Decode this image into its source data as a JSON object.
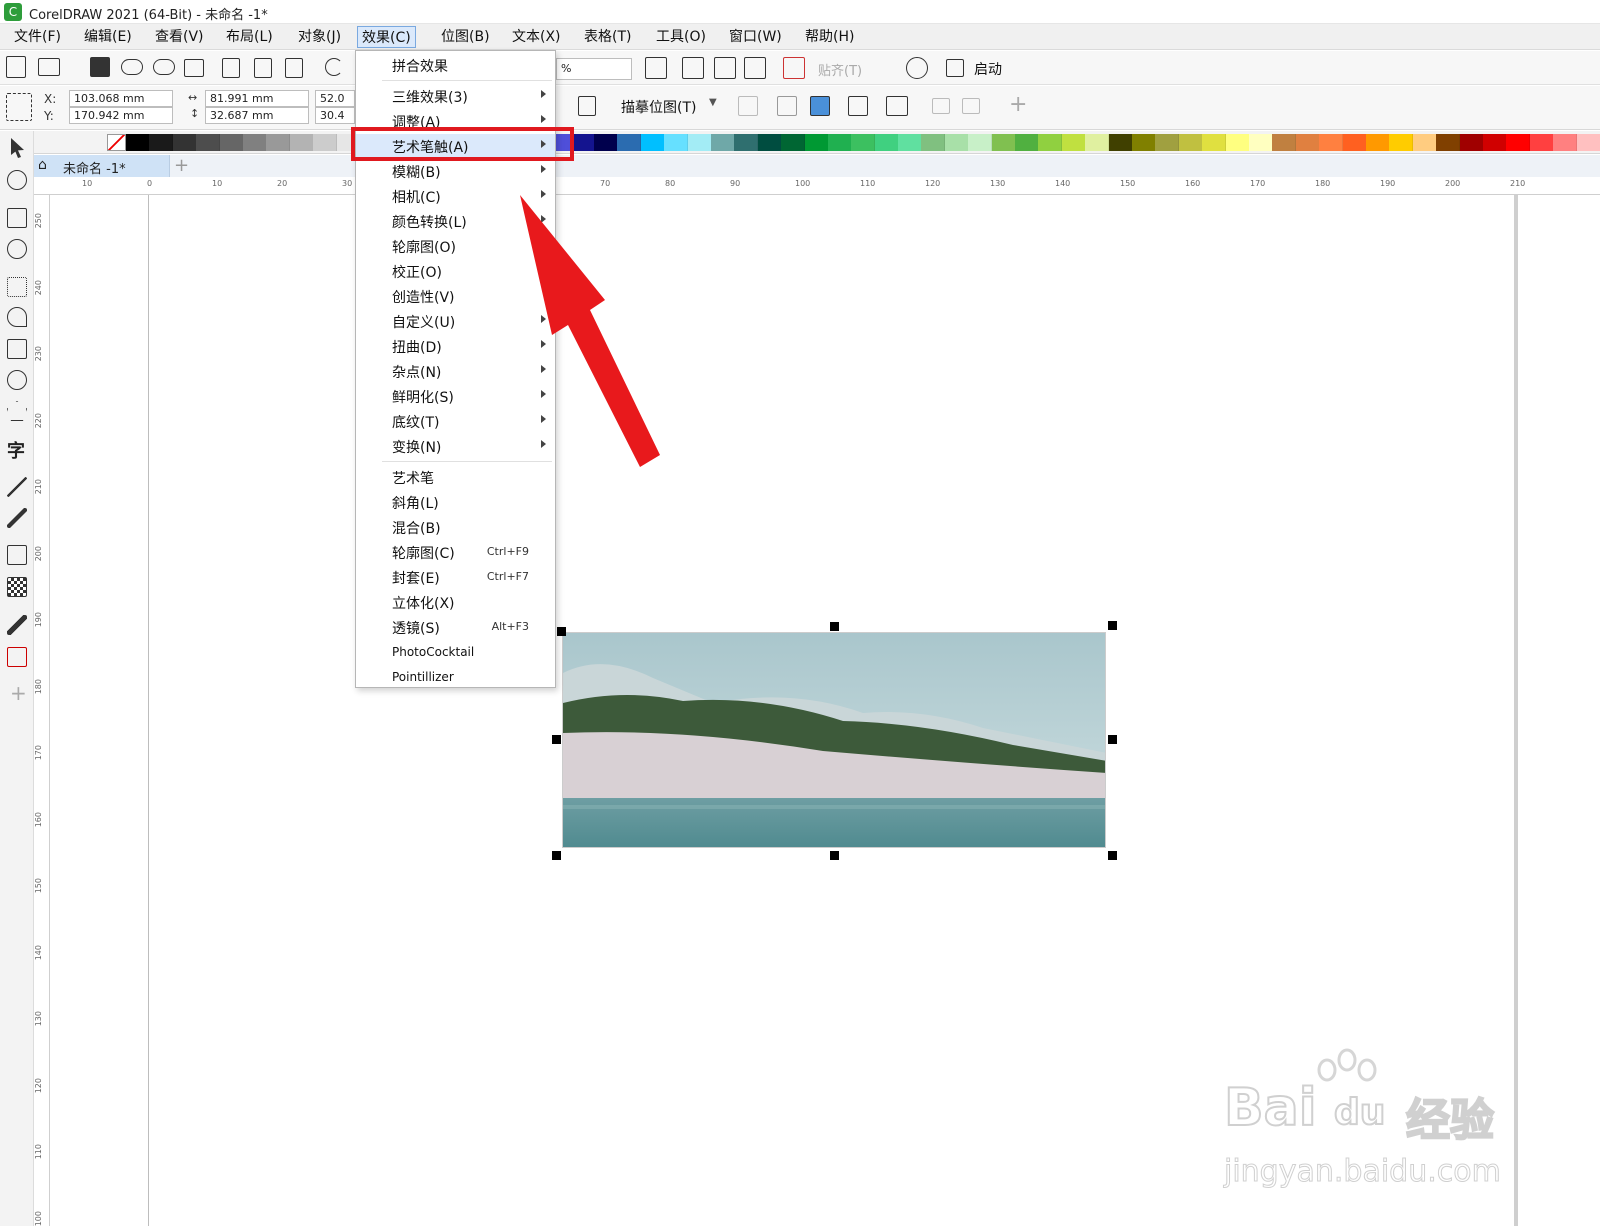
{
  "app": {
    "title": "CorelDRAW 2021 (64-Bit) - 未命名 -1*",
    "brand_color": "#2e9d3b"
  },
  "menu": [
    "文件(F)",
    "编辑(E)",
    "查看(V)",
    "布局(L)",
    "对象(J)",
    "效果(C)",
    "位图(B)",
    "文本(X)",
    "表格(T)",
    "工具(O)",
    "窗口(W)",
    "帮助(H)"
  ],
  "toolbar": {
    "zoom_suffix": "%",
    "snap_label": "贴齐(T)",
    "start_label": "启动",
    "trace_label": "描摹位图(T)"
  },
  "props": {
    "x_label": "X:",
    "y_label": "Y:",
    "x": "103.068 mm",
    "y": "170.942 mm",
    "w": "81.991 mm",
    "h": "32.687 mm",
    "scale_w": "52.0",
    "scale_h": "30.4"
  },
  "palette_colors": [
    "#000000",
    "#1a1a1a",
    "#333333",
    "#4d4d4d",
    "#666666",
    "#808080",
    "#999999",
    "#b3b3b3",
    "#cccccc",
    "#e6e6e6",
    "#ffffff",
    "#2b2bd1",
    "#4b4be6",
    "#6c6cf0",
    "#8e8ef5",
    "#9aa9f7",
    "#7f9cf5",
    "#6b7ef0",
    "#4f4fd9",
    "#14148f",
    "#00004d",
    "#2b6cb0",
    "#00bfff",
    "#66e0ff",
    "#a3ecf5",
    "#6fa8a8",
    "#2f6f6f",
    "#004d40",
    "#006633",
    "#009933",
    "#20b050",
    "#3cc060",
    "#40d080",
    "#60e0a0",
    "#80c080",
    "#a8e0a8",
    "#c8f0c8",
    "#80c050",
    "#50b040",
    "#90d040",
    "#c0e040",
    "#e0f0a0",
    "#404000",
    "#808000",
    "#a0a040",
    "#c0c040",
    "#e0e040",
    "#ffff80",
    "#ffffc0",
    "#c08040",
    "#e08040",
    "#ff8040",
    "#ff6020",
    "#ff9900",
    "#ffcc00",
    "#ffcc80",
    "#804000",
    "#a00000",
    "#d00000",
    "#ff0000",
    "#ff4040",
    "#ff8080",
    "#ffc0c0"
  ],
  "document": {
    "tab_name": "未命名 -1*"
  },
  "ruler": {
    "h_ticks": [
      "10",
      "0",
      "10",
      "20",
      "30",
      "70",
      "80",
      "90",
      "100",
      "110",
      "120",
      "130",
      "140",
      "150",
      "160",
      "170",
      "180",
      "190",
      "200",
      "210"
    ],
    "v_ticks": [
      "250",
      "240",
      "230",
      "220",
      "210",
      "200",
      "190",
      "180",
      "170",
      "160",
      "150",
      "140",
      "130",
      "120",
      "110",
      "100"
    ]
  },
  "effects_menu": {
    "top": [
      {
        "label": "拼合效果"
      }
    ],
    "group1": [
      {
        "label": "三维效果(3)",
        "submenu": true
      },
      {
        "label": "调整(A)",
        "submenu": true
      },
      {
        "label": "艺术笔触(A)",
        "submenu": true,
        "highlighted": true
      },
      {
        "label": "模糊(B)",
        "submenu": true
      },
      {
        "label": "相机(C)",
        "submenu": true
      },
      {
        "label": "颜色转换(L)",
        "submenu": true
      },
      {
        "label": "轮廓图(O)",
        "submenu": false
      },
      {
        "label": "校正(O)",
        "submenu": false
      },
      {
        "label": "创造性(V)",
        "submenu": false
      },
      {
        "label": "自定义(U)",
        "submenu": true
      },
      {
        "label": "扭曲(D)",
        "submenu": true
      },
      {
        "label": "杂点(N)",
        "submenu": true
      },
      {
        "label": "鲜明化(S)",
        "submenu": true
      },
      {
        "label": "底纹(T)",
        "submenu": true
      },
      {
        "label": "变换(N)",
        "submenu": true
      }
    ],
    "group2": [
      {
        "label": "艺术笔",
        "shortcut": ""
      },
      {
        "label": "斜角(L)",
        "shortcut": ""
      },
      {
        "label": "混合(B)",
        "shortcut": ""
      },
      {
        "label": "轮廓图(C)",
        "shortcut": "Ctrl+F9"
      },
      {
        "label": "封套(E)",
        "shortcut": "Ctrl+F7"
      },
      {
        "label": "立体化(X)",
        "shortcut": ""
      },
      {
        "label": "透镜(S)",
        "shortcut": "Alt+F3"
      },
      {
        "label": "PhotoCocktail",
        "shortcut": ""
      },
      {
        "label": "Pointillizer",
        "shortcut": ""
      }
    ]
  },
  "annotation": {
    "highlight_color": "#e0191f"
  },
  "watermark": {
    "brand": "Bai",
    "paw": "du",
    "cn": "经验",
    "url": "jingyan.baidu.com"
  }
}
